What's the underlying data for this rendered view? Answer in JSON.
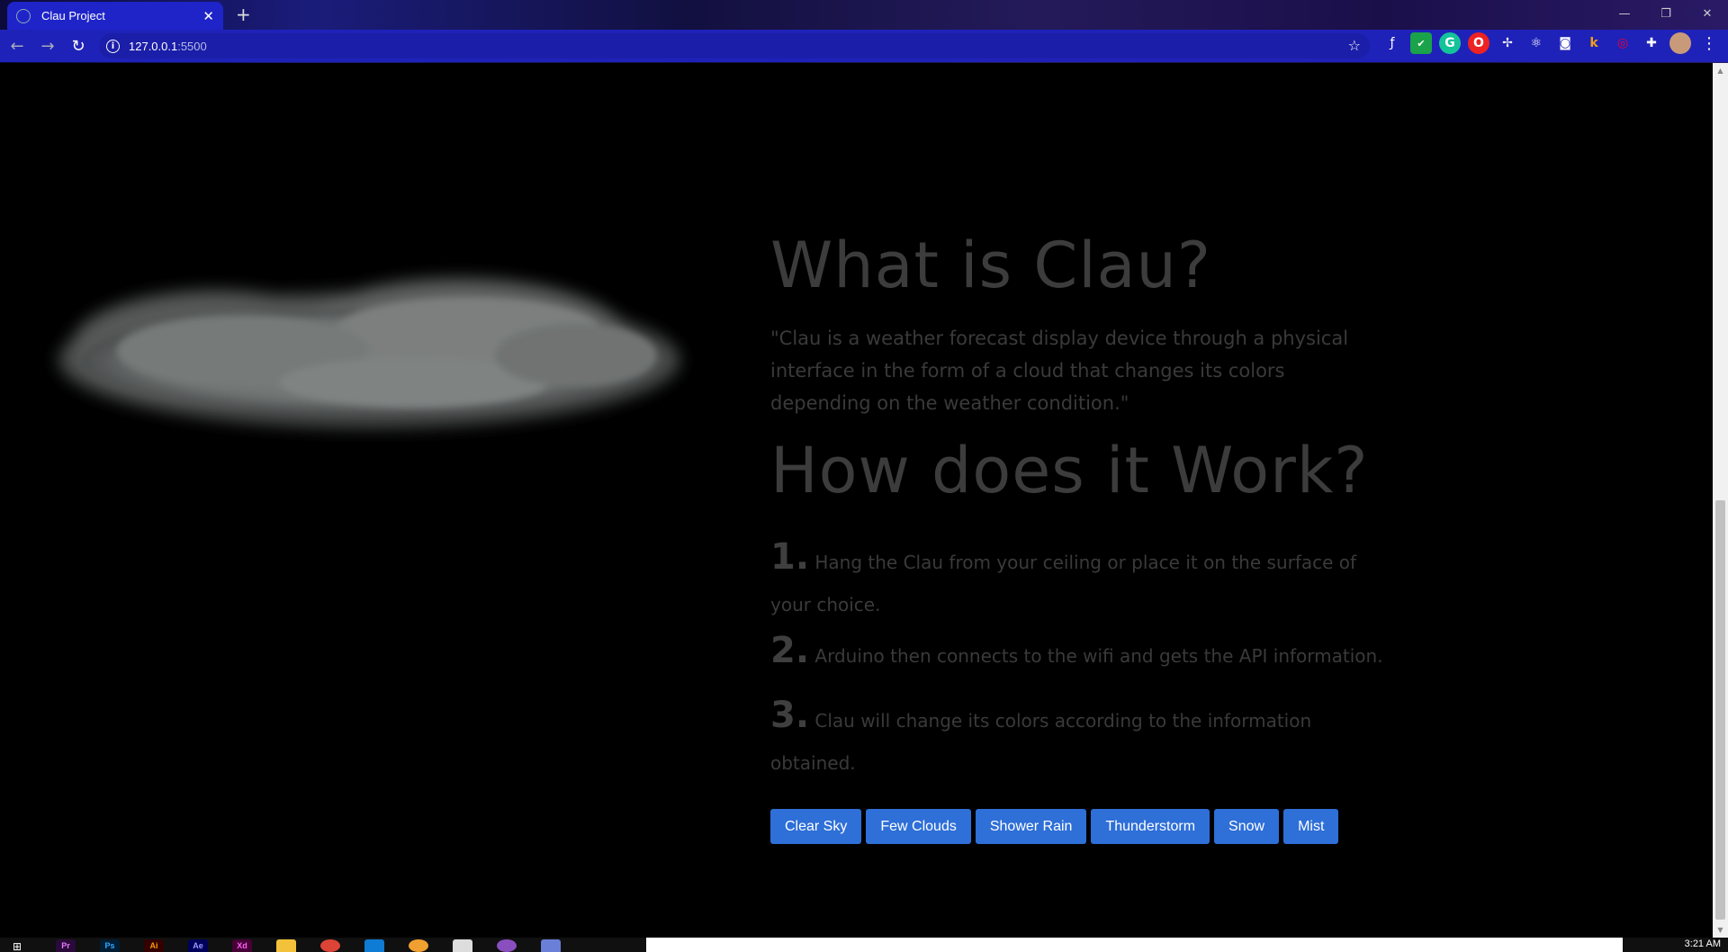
{
  "browser": {
    "tab_title": "Clau Project",
    "new_tab_glyph": "+",
    "url_host": "127.0.0.1",
    "url_port": ":5500",
    "window_controls": [
      "—",
      "❐",
      "✕"
    ]
  },
  "page": {
    "heading_what": "What is Clau?",
    "description": "\"Clau is a weather forecast display device through a physical interface in the form of a cloud that changes its colors depending on the weather condition.\"",
    "heading_how": "How does it Work?",
    "steps": [
      {
        "num": "1.",
        "text": "Hang the Clau from your ceiling or place it on the surface of your choice."
      },
      {
        "num": "2.",
        "text": "Arduino then connects to the wifi and gets the API information."
      },
      {
        "num": "3.",
        "text": "Clau will change its colors according to the information obtained."
      }
    ],
    "buttons": [
      "Clear Sky",
      "Few Clouds",
      "Shower Rain",
      "Thunderstorm",
      "Snow",
      "Mist"
    ]
  },
  "taskbar": {
    "apps": [
      "Pr",
      "Ps",
      "Ai",
      "Ae",
      "Xd"
    ],
    "clock": "3:21 AM"
  },
  "colors": {
    "button_bg": "#2e6fd8",
    "page_bg": "#000000",
    "text": "#3a3a3a",
    "tab_active": "#1e24c8"
  }
}
